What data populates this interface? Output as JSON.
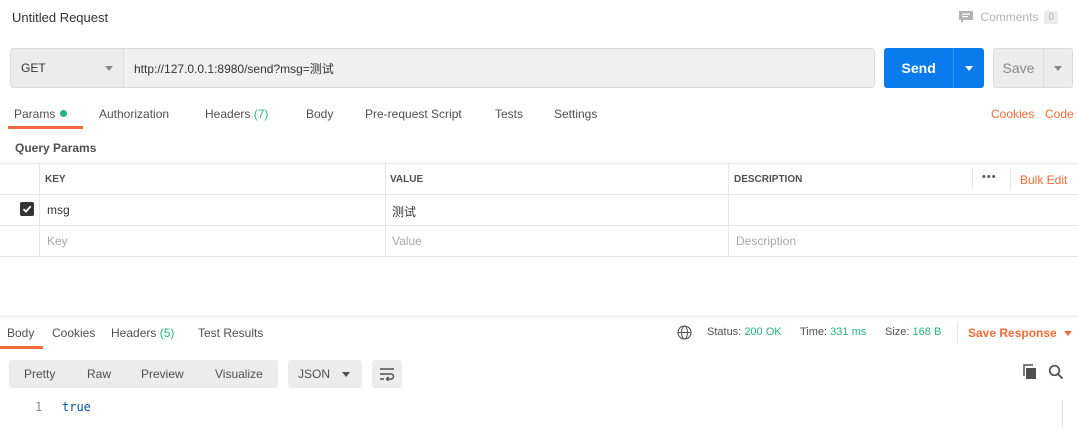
{
  "title": "Untitled Request",
  "comments": {
    "label": "Comments",
    "count": "0"
  },
  "request": {
    "method": "GET",
    "url": "http://127.0.0.1:8980/send?msg=测试",
    "send_label": "Send",
    "save_label": "Save"
  },
  "request_tabs": {
    "params": "Params",
    "authorization": "Authorization",
    "headers": "Headers",
    "headers_count": "(7)",
    "body": "Body",
    "prerequest": "Pre-request Script",
    "tests": "Tests",
    "settings": "Settings",
    "cookies": "Cookies",
    "code": "Code"
  },
  "query_params": {
    "title": "Query Params",
    "columns": {
      "key": "KEY",
      "value": "VALUE",
      "description": "DESCRIPTION"
    },
    "more": "•••",
    "bulk_edit": "Bulk Edit",
    "rows": [
      {
        "checked": true,
        "key": "msg",
        "value": "测试",
        "description": ""
      }
    ],
    "placeholders": {
      "key": "Key",
      "value": "Value",
      "description": "Description"
    }
  },
  "response": {
    "tabs": {
      "body": "Body",
      "cookies": "Cookies",
      "headers": "Headers",
      "headers_count": "(5)",
      "test_results": "Test Results"
    },
    "status_label": "Status:",
    "status_value": "200 OK",
    "time_label": "Time:",
    "time_value": "331 ms",
    "size_label": "Size:",
    "size_value": "168 B",
    "save_response": "Save Response",
    "views": {
      "pretty": "Pretty",
      "raw": "Raw",
      "preview": "Preview",
      "visualize": "Visualize"
    },
    "format": "JSON",
    "lines": [
      {
        "number": "1",
        "content": "true"
      }
    ]
  },
  "colors": {
    "accent": "#f26b3a",
    "send": "#097bed",
    "success": "#26b47f"
  }
}
